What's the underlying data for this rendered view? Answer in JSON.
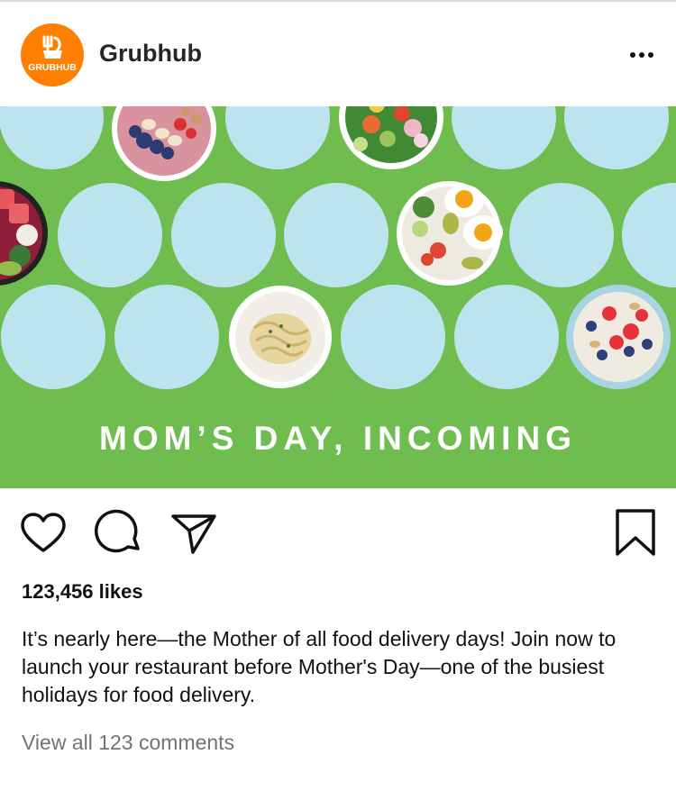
{
  "post": {
    "account_name": "Grubhub",
    "avatar_text": "GRUBHUB",
    "avatar_color": "#ff8000",
    "more_icon": "more-horizontal-icon",
    "image": {
      "caption": "MOM’S DAY, INCOMING",
      "background_color": "#6fbd4f",
      "circle_color": "#bde4ee",
      "dishes": [
        "smoothie-bowl",
        "salad-bowl",
        "poke-bowl",
        "eggs-and-salad-plate",
        "pasta-plate",
        "oatmeal-with-berries"
      ]
    },
    "actions": {
      "like_icon": "heart-icon",
      "comment_icon": "comment-icon",
      "share_icon": "paper-plane-icon",
      "save_icon": "bookmark-icon"
    },
    "likes": "123,456 likes",
    "caption": "It’s nearly here—the Mother of all food delivery days! Join now to launch your restaurant before Mother's Day—one of the busiest holidays for food delivery.",
    "view_comments": "View all 123 comments"
  }
}
